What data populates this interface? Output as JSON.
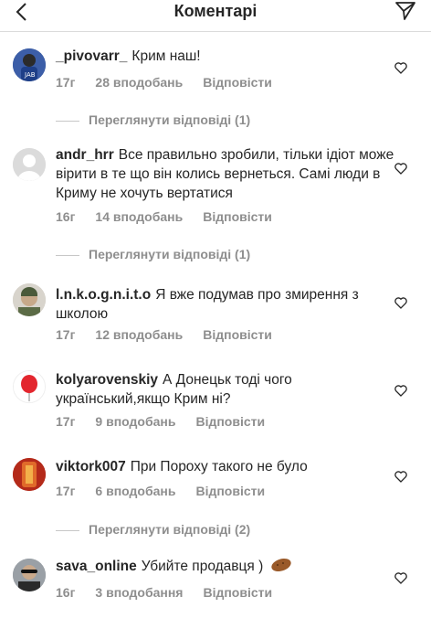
{
  "header": {
    "title": "Коментарі",
    "back_icon": "chevron-left-icon",
    "send_icon": "direct-send-icon"
  },
  "comments": [
    {
      "user": "_pivovarr_",
      "text": "Крим наш!",
      "time": "17г",
      "likes": "28 вподобань",
      "reply": "Відповісти",
      "view_replies": "Переглянути відповіді (1)"
    },
    {
      "user": "andr_hrr",
      "text": "Все правильно зробили, тільки ідіот може вірити в те що він колись вернеться. Самі люди в Криму не хочуть вертатися",
      "time": "16г",
      "likes": "14 вподобань",
      "reply": "Відповісти",
      "view_replies": "Переглянути відповіді (1)"
    },
    {
      "user": "l.n.k.o.g.n.i.t.o",
      "text": "Я вже подумав про змирення з школою",
      "time": "17г",
      "likes": "12 вподобань",
      "reply": "Відповісти"
    },
    {
      "user": "kolyarovenskiy",
      "text": "А Донецьк тоді чого український,якщо Крим ні?",
      "time": "17г",
      "likes": "9 вподобань",
      "reply": "Відповісти"
    },
    {
      "user": "viktork007",
      "text": "При Пороху такого не було",
      "time": "17г",
      "likes": "6 вподобань",
      "reply": "Відповісти",
      "view_replies": "Переглянути відповіді (2)"
    },
    {
      "user": "sava_online",
      "text": "Убийте продавця )",
      "time": "16г",
      "likes": "3 вподобання",
      "reply": "Відповісти"
    }
  ],
  "colors": {
    "text": "#262626",
    "meta": "#8e8e8e",
    "divider": "#dbdbdb"
  }
}
